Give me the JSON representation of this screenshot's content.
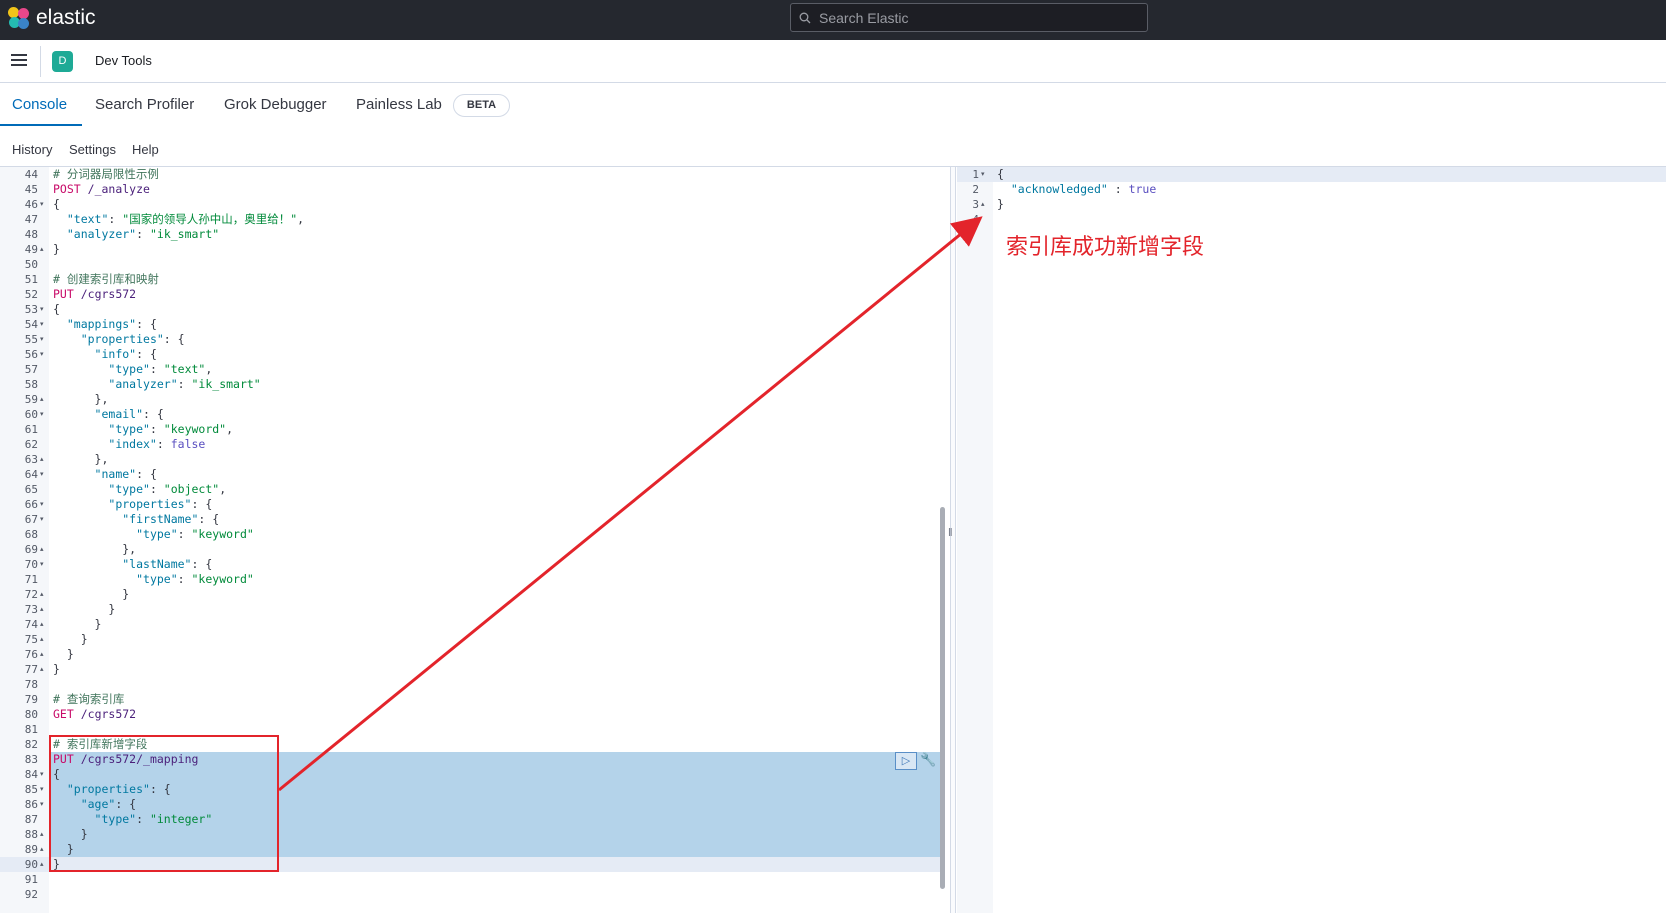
{
  "topbar": {
    "brand": "elastic",
    "search_placeholder": "Search Elastic"
  },
  "subbar": {
    "app_badge": "D",
    "breadcrumb": "Dev Tools"
  },
  "tabs": [
    {
      "label": "Console",
      "active": true
    },
    {
      "label": "Search Profiler",
      "active": false
    },
    {
      "label": "Grok Debugger",
      "active": false
    },
    {
      "label": "Painless Lab",
      "active": false
    }
  ],
  "beta_badge": "BETA",
  "menu": {
    "history": "History",
    "settings": "Settings",
    "help": "Help"
  },
  "editor_lines": [
    {
      "n": "44",
      "fold": "",
      "segs": [
        [
          "c-comment",
          "# 分词器局限性示例"
        ]
      ]
    },
    {
      "n": "45",
      "fold": "",
      "segs": [
        [
          "c-method",
          "POST"
        ],
        [
          "c-punct",
          " "
        ],
        [
          "c-url",
          "/_analyze"
        ]
      ]
    },
    {
      "n": "46",
      "fold": "▾",
      "segs": [
        [
          "c-punct",
          "{"
        ]
      ]
    },
    {
      "n": "47",
      "fold": "",
      "segs": [
        [
          "c-punct",
          "  "
        ],
        [
          "c-key",
          "\"text\""
        ],
        [
          "c-punct",
          ": "
        ],
        [
          "c-str",
          "\"国家的领导人孙中山，奥里给！\""
        ],
        [
          "c-punct",
          ","
        ]
      ]
    },
    {
      "n": "48",
      "fold": "",
      "segs": [
        [
          "c-punct",
          "  "
        ],
        [
          "c-key",
          "\"analyzer\""
        ],
        [
          "c-punct",
          ": "
        ],
        [
          "c-str",
          "\"ik_smart\""
        ]
      ]
    },
    {
      "n": "49",
      "fold": "▴",
      "segs": [
        [
          "c-punct",
          "}"
        ]
      ]
    },
    {
      "n": "50",
      "fold": "",
      "segs": []
    },
    {
      "n": "51",
      "fold": "",
      "segs": [
        [
          "c-comment",
          "# 创建索引库和映射"
        ]
      ]
    },
    {
      "n": "52",
      "fold": "",
      "segs": [
        [
          "c-method",
          "PUT"
        ],
        [
          "c-punct",
          " "
        ],
        [
          "c-url",
          "/cgrs572"
        ]
      ]
    },
    {
      "n": "53",
      "fold": "▾",
      "segs": [
        [
          "c-punct",
          "{"
        ]
      ]
    },
    {
      "n": "54",
      "fold": "▾",
      "segs": [
        [
          "c-punct",
          "  "
        ],
        [
          "c-key",
          "\"mappings\""
        ],
        [
          "c-punct",
          ": {"
        ]
      ]
    },
    {
      "n": "55",
      "fold": "▾",
      "segs": [
        [
          "c-punct",
          "    "
        ],
        [
          "c-key",
          "\"properties\""
        ],
        [
          "c-punct",
          ": {"
        ]
      ]
    },
    {
      "n": "56",
      "fold": "▾",
      "segs": [
        [
          "c-punct",
          "      "
        ],
        [
          "c-key",
          "\"info\""
        ],
        [
          "c-punct",
          ": {"
        ]
      ]
    },
    {
      "n": "57",
      "fold": "",
      "segs": [
        [
          "c-punct",
          "        "
        ],
        [
          "c-key",
          "\"type\""
        ],
        [
          "c-punct",
          ": "
        ],
        [
          "c-str",
          "\"text\""
        ],
        [
          "c-punct",
          ","
        ]
      ]
    },
    {
      "n": "58",
      "fold": "",
      "segs": [
        [
          "c-punct",
          "        "
        ],
        [
          "c-key",
          "\"analyzer\""
        ],
        [
          "c-punct",
          ": "
        ],
        [
          "c-str",
          "\"ik_smart\""
        ]
      ]
    },
    {
      "n": "59",
      "fold": "▴",
      "segs": [
        [
          "c-punct",
          "      },"
        ]
      ]
    },
    {
      "n": "60",
      "fold": "▾",
      "segs": [
        [
          "c-punct",
          "      "
        ],
        [
          "c-key",
          "\"email\""
        ],
        [
          "c-punct",
          ": {"
        ]
      ]
    },
    {
      "n": "61",
      "fold": "",
      "segs": [
        [
          "c-punct",
          "        "
        ],
        [
          "c-key",
          "\"type\""
        ],
        [
          "c-punct",
          ": "
        ],
        [
          "c-str",
          "\"keyword\""
        ],
        [
          "c-punct",
          ","
        ]
      ]
    },
    {
      "n": "62",
      "fold": "",
      "segs": [
        [
          "c-punct",
          "        "
        ],
        [
          "c-key",
          "\"index\""
        ],
        [
          "c-punct",
          ": "
        ],
        [
          "c-bool",
          "false"
        ]
      ]
    },
    {
      "n": "63",
      "fold": "▴",
      "segs": [
        [
          "c-punct",
          "      },"
        ]
      ]
    },
    {
      "n": "64",
      "fold": "▾",
      "segs": [
        [
          "c-punct",
          "      "
        ],
        [
          "c-key",
          "\"name\""
        ],
        [
          "c-punct",
          ": {"
        ]
      ]
    },
    {
      "n": "65",
      "fold": "",
      "segs": [
        [
          "c-punct",
          "        "
        ],
        [
          "c-key",
          "\"type\""
        ],
        [
          "c-punct",
          ": "
        ],
        [
          "c-str",
          "\"object\""
        ],
        [
          "c-punct",
          ","
        ]
      ]
    },
    {
      "n": "66",
      "fold": "▾",
      "segs": [
        [
          "c-punct",
          "        "
        ],
        [
          "c-key",
          "\"properties\""
        ],
        [
          "c-punct",
          ": {"
        ]
      ]
    },
    {
      "n": "67",
      "fold": "▾",
      "segs": [
        [
          "c-punct",
          "          "
        ],
        [
          "c-key",
          "\"firstName\""
        ],
        [
          "c-punct",
          ": {"
        ]
      ]
    },
    {
      "n": "68",
      "fold": "",
      "segs": [
        [
          "c-punct",
          "            "
        ],
        [
          "c-key",
          "\"type\""
        ],
        [
          "c-punct",
          ": "
        ],
        [
          "c-str",
          "\"keyword\""
        ]
      ]
    },
    {
      "n": "69",
      "fold": "▴",
      "segs": [
        [
          "c-punct",
          "          },"
        ]
      ]
    },
    {
      "n": "70",
      "fold": "▾",
      "segs": [
        [
          "c-punct",
          "          "
        ],
        [
          "c-key",
          "\"lastName\""
        ],
        [
          "c-punct",
          ": {"
        ]
      ]
    },
    {
      "n": "71",
      "fold": "",
      "segs": [
        [
          "c-punct",
          "            "
        ],
        [
          "c-key",
          "\"type\""
        ],
        [
          "c-punct",
          ": "
        ],
        [
          "c-str",
          "\"keyword\""
        ]
      ]
    },
    {
      "n": "72",
      "fold": "▴",
      "segs": [
        [
          "c-punct",
          "          }"
        ]
      ]
    },
    {
      "n": "73",
      "fold": "▴",
      "segs": [
        [
          "c-punct",
          "        }"
        ]
      ]
    },
    {
      "n": "74",
      "fold": "▴",
      "segs": [
        [
          "c-punct",
          "      }"
        ]
      ]
    },
    {
      "n": "75",
      "fold": "▴",
      "segs": [
        [
          "c-punct",
          "    }"
        ]
      ]
    },
    {
      "n": "76",
      "fold": "▴",
      "segs": [
        [
          "c-punct",
          "  }"
        ]
      ]
    },
    {
      "n": "77",
      "fold": "▴",
      "segs": [
        [
          "c-punct",
          "}"
        ]
      ]
    },
    {
      "n": "78",
      "fold": "",
      "segs": []
    },
    {
      "n": "79",
      "fold": "",
      "segs": [
        [
          "c-comment",
          "# 查询索引库"
        ]
      ]
    },
    {
      "n": "80",
      "fold": "",
      "segs": [
        [
          "c-method",
          "GET"
        ],
        [
          "c-punct",
          " "
        ],
        [
          "c-url",
          "/cgrs572"
        ]
      ]
    },
    {
      "n": "81",
      "fold": "",
      "segs": []
    },
    {
      "n": "82",
      "fold": "",
      "segs": [
        [
          "c-comment",
          "# 索引库新增字段"
        ]
      ]
    },
    {
      "n": "83",
      "fold": "",
      "segs": [
        [
          "c-method",
          "PUT"
        ],
        [
          "c-punct",
          " "
        ],
        [
          "c-url",
          "/cgrs572/_mapping"
        ]
      ]
    },
    {
      "n": "84",
      "fold": "▾",
      "segs": [
        [
          "c-punct",
          "{"
        ]
      ]
    },
    {
      "n": "85",
      "fold": "▾",
      "segs": [
        [
          "c-punct",
          "  "
        ],
        [
          "c-key",
          "\"properties\""
        ],
        [
          "c-punct",
          ": {"
        ]
      ]
    },
    {
      "n": "86",
      "fold": "▾",
      "segs": [
        [
          "c-punct",
          "    "
        ],
        [
          "c-key",
          "\"age\""
        ],
        [
          "c-punct",
          ": {"
        ]
      ]
    },
    {
      "n": "87",
      "fold": "",
      "segs": [
        [
          "c-punct",
          "      "
        ],
        [
          "c-key",
          "\"type\""
        ],
        [
          "c-punct",
          ": "
        ],
        [
          "c-str",
          "\"integer\""
        ]
      ]
    },
    {
      "n": "88",
      "fold": "▴",
      "segs": [
        [
          "c-punct",
          "    }"
        ]
      ]
    },
    {
      "n": "89",
      "fold": "▴",
      "segs": [
        [
          "c-punct",
          "  }"
        ]
      ]
    },
    {
      "n": "90",
      "fold": "▴",
      "segs": [
        [
          "c-punct",
          "}"
        ]
      ]
    },
    {
      "n": "91",
      "fold": "",
      "segs": []
    },
    {
      "n": "92",
      "fold": "",
      "segs": []
    }
  ],
  "output_lines": [
    {
      "n": "1",
      "fold": "▾",
      "segs": [
        [
          "c-punct",
          "{"
        ]
      ]
    },
    {
      "n": "2",
      "fold": "",
      "segs": [
        [
          "c-punct",
          "  "
        ],
        [
          "c-key",
          "\"acknowledged\""
        ],
        [
          "c-punct",
          " : "
        ],
        [
          "c-bool",
          "true"
        ]
      ]
    },
    {
      "n": "3",
      "fold": "▴",
      "segs": [
        [
          "c-punct",
          "}"
        ]
      ]
    },
    {
      "n": "4",
      "fold": "",
      "segs": []
    }
  ],
  "annotation_text": "索引库成功新增字段",
  "colors": {
    "annotation": "#e3242b",
    "selection": "#b4d3ea",
    "accent": "#006bb8"
  }
}
